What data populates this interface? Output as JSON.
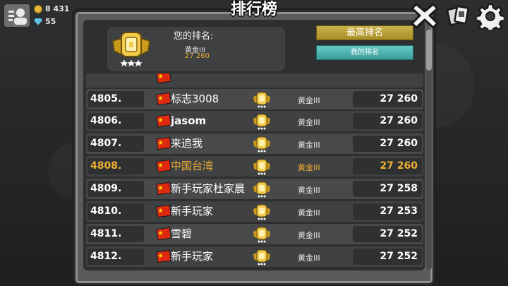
{
  "hud": {
    "coins": "8 431",
    "gems": "55"
  },
  "title": "排行榜",
  "my_rank": {
    "label": "您的排名:",
    "tier": "黄金III",
    "score": "27 260"
  },
  "tabs": {
    "best": "最高排名",
    "mine": "我的排名"
  },
  "rows": [
    {
      "rank": "4805.",
      "name": "标志3008",
      "tier": "黄金III",
      "score": "27 260",
      "me": false
    },
    {
      "rank": "4806.",
      "name": "jasom",
      "tier": "黄金III",
      "score": "27 260",
      "me": false
    },
    {
      "rank": "4807.",
      "name": "来追我",
      "tier": "黄金III",
      "score": "27 260",
      "me": false
    },
    {
      "rank": "4808.",
      "name": "中国台湾",
      "tier": "黄金III",
      "score": "27 260",
      "me": true
    },
    {
      "rank": "4809.",
      "name": "新手玩家杜家晨",
      "tier": "黄金III",
      "score": "27 258",
      "me": false
    },
    {
      "rank": "4810.",
      "name": "新手玩家",
      "tier": "黄金III",
      "score": "27 253",
      "me": false
    },
    {
      "rank": "4811.",
      "name": "雪碧",
      "tier": "黄金III",
      "score": "27 252",
      "me": false
    },
    {
      "rank": "4812.",
      "name": "新手玩家",
      "tier": "黄金III",
      "score": "27 252",
      "me": false
    }
  ],
  "icons": {
    "player": "player-profile-icon",
    "coin": "coin-icon",
    "gem": "gem-icon",
    "close": "close-icon",
    "cards": "cards-icon",
    "settings": "gear-icon",
    "badge": "gold-league-badge-icon",
    "flag": "china-flag-icon"
  },
  "colors": {
    "highlight": "#f0b030",
    "best_tab": "#b89d30",
    "mine_tab": "#4db4b0"
  }
}
